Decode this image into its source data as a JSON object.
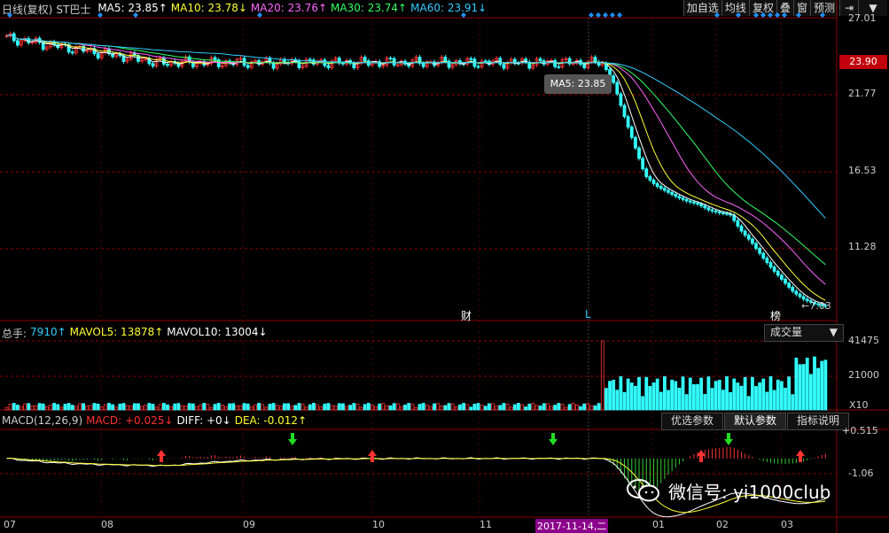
{
  "header": {
    "title": "日线(复权)",
    "stock": "ST巴士",
    "ma_items": [
      {
        "label": "MA5: 23.85↑",
        "color": "#ffffff"
      },
      {
        "label": "MA10: 23.78↓",
        "color": "#ffff33"
      },
      {
        "label": "MA20: 23.76↑",
        "color": "#ff66ff"
      },
      {
        "label": "MA30: 23.74↑",
        "color": "#33ff66"
      },
      {
        "label": "MA60: 23.91↓",
        "color": "#33ccff"
      }
    ]
  },
  "toolbar": {
    "items": [
      "加自选",
      "均线",
      "复权",
      "叠",
      "窗",
      "预测"
    ],
    "exit_icon": "exit-icon",
    "dropdown_icon": "chevron-down-icon"
  },
  "price_axis": {
    "ticks": [
      "27.01",
      "21.77",
      "16.53",
      "11.28"
    ],
    "current_price": "23.90",
    "latest_label": "7.03"
  },
  "tooltip": {
    "text": "MA5: 23.85"
  },
  "markers": {
    "cai": "财",
    "L": "L",
    "bang": "榜"
  },
  "volume": {
    "header": [
      {
        "label": "总手:",
        "color": "#cccccc"
      },
      {
        "label": "7910↑",
        "color": "#33ccff"
      },
      {
        "label": "MAVOL5: 13878↑",
        "color": "#ffff33"
      },
      {
        "label": "MAVOL10: 13004↓",
        "color": "#ffffff"
      }
    ],
    "selector": "成交量",
    "ticks": [
      "41475",
      "21000"
    ],
    "unit": "X10"
  },
  "macd": {
    "header": [
      {
        "label": "MACD(12,26,9)",
        "color": "#cccccc"
      },
      {
        "label": "MACD: +0.025↓",
        "color": "#ff3333"
      },
      {
        "label": "DIFF: +0↓",
        "color": "#ffffff"
      },
      {
        "label": "DEA: -0.012↑",
        "color": "#ffff33"
      }
    ],
    "buttons": [
      "优选参数",
      "默认参数",
      "指标说明"
    ],
    "ticks": [
      "+0.515",
      "-1.06"
    ]
  },
  "x_axis": {
    "labels": [
      "07",
      "08",
      "09",
      "10",
      "11",
      "01",
      "02",
      "03"
    ],
    "highlight": "2017-11-14,二"
  },
  "watermark": {
    "text": "微信号: yi1000club"
  },
  "colors": {
    "up": "#ff3333",
    "down": "#33ffff",
    "grid": "#8b0000",
    "accent_blue": "#1e90ff"
  },
  "chart_data": {
    "type": "candlestick",
    "price_series_approx": {
      "flat_period_level": 23.9,
      "start_level": 25.6,
      "post_2017_11_14_levels": [
        23.85,
        22.6,
        20.3,
        18.2,
        16.1,
        15.4,
        15.0,
        14.6,
        14.3,
        14.1,
        13.7,
        13.5,
        13.4,
        12.3,
        11.5,
        10.5,
        9.6,
        8.8,
        8.0,
        7.5,
        7.2,
        7.03
      ]
    },
    "ylim": [
      7.03,
      27.01
    ],
    "volume_ylim": [
      0,
      41475
    ],
    "macd_ylim": [
      -1.06,
      0.515
    ]
  }
}
